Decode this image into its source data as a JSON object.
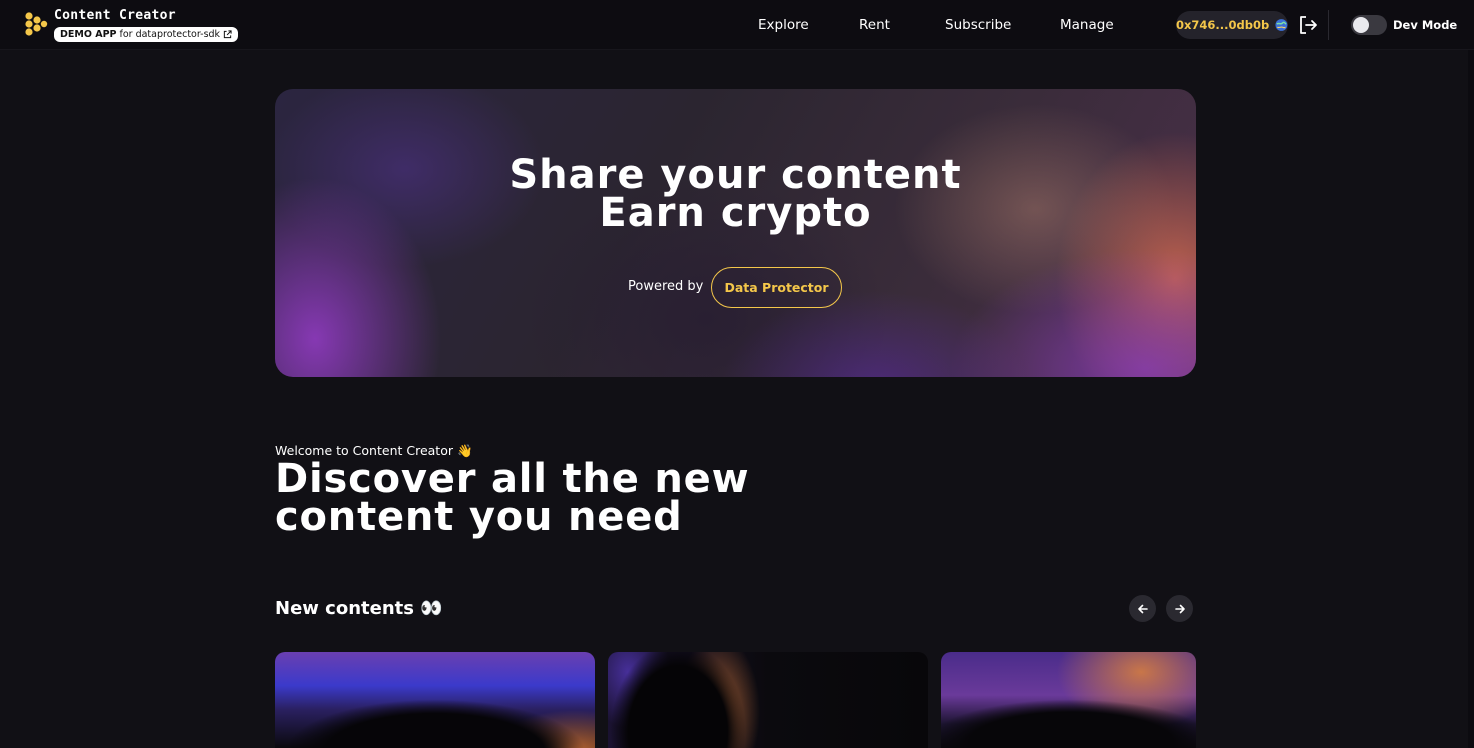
{
  "header": {
    "brand_title": "Content Creator",
    "demo_badge_strong": "DEMO APP",
    "demo_badge_rest": "for dataprotector-sdk",
    "nav": [
      {
        "label": "Explore"
      },
      {
        "label": "Rent"
      },
      {
        "label": "Subscribe"
      },
      {
        "label": "Manage"
      }
    ],
    "wallet_address": "0x746...0db0b",
    "dev_mode_label": "Dev Mode",
    "dev_mode_enabled": false
  },
  "hero": {
    "title_line1": "Share your content",
    "title_line2": "Earn crypto",
    "powered_by": "Powered by",
    "cta_label": "Data Protector"
  },
  "intro": {
    "welcome": "Welcome to Content Creator 👋",
    "headline_line1": "Discover all the new",
    "headline_line2": "content you need"
  },
  "new_contents": {
    "title": "New contents 👀",
    "cards": [
      {},
      {},
      {}
    ]
  },
  "colors": {
    "accent": "#f4c74a",
    "background": "#111015",
    "surface": "#24232b"
  }
}
